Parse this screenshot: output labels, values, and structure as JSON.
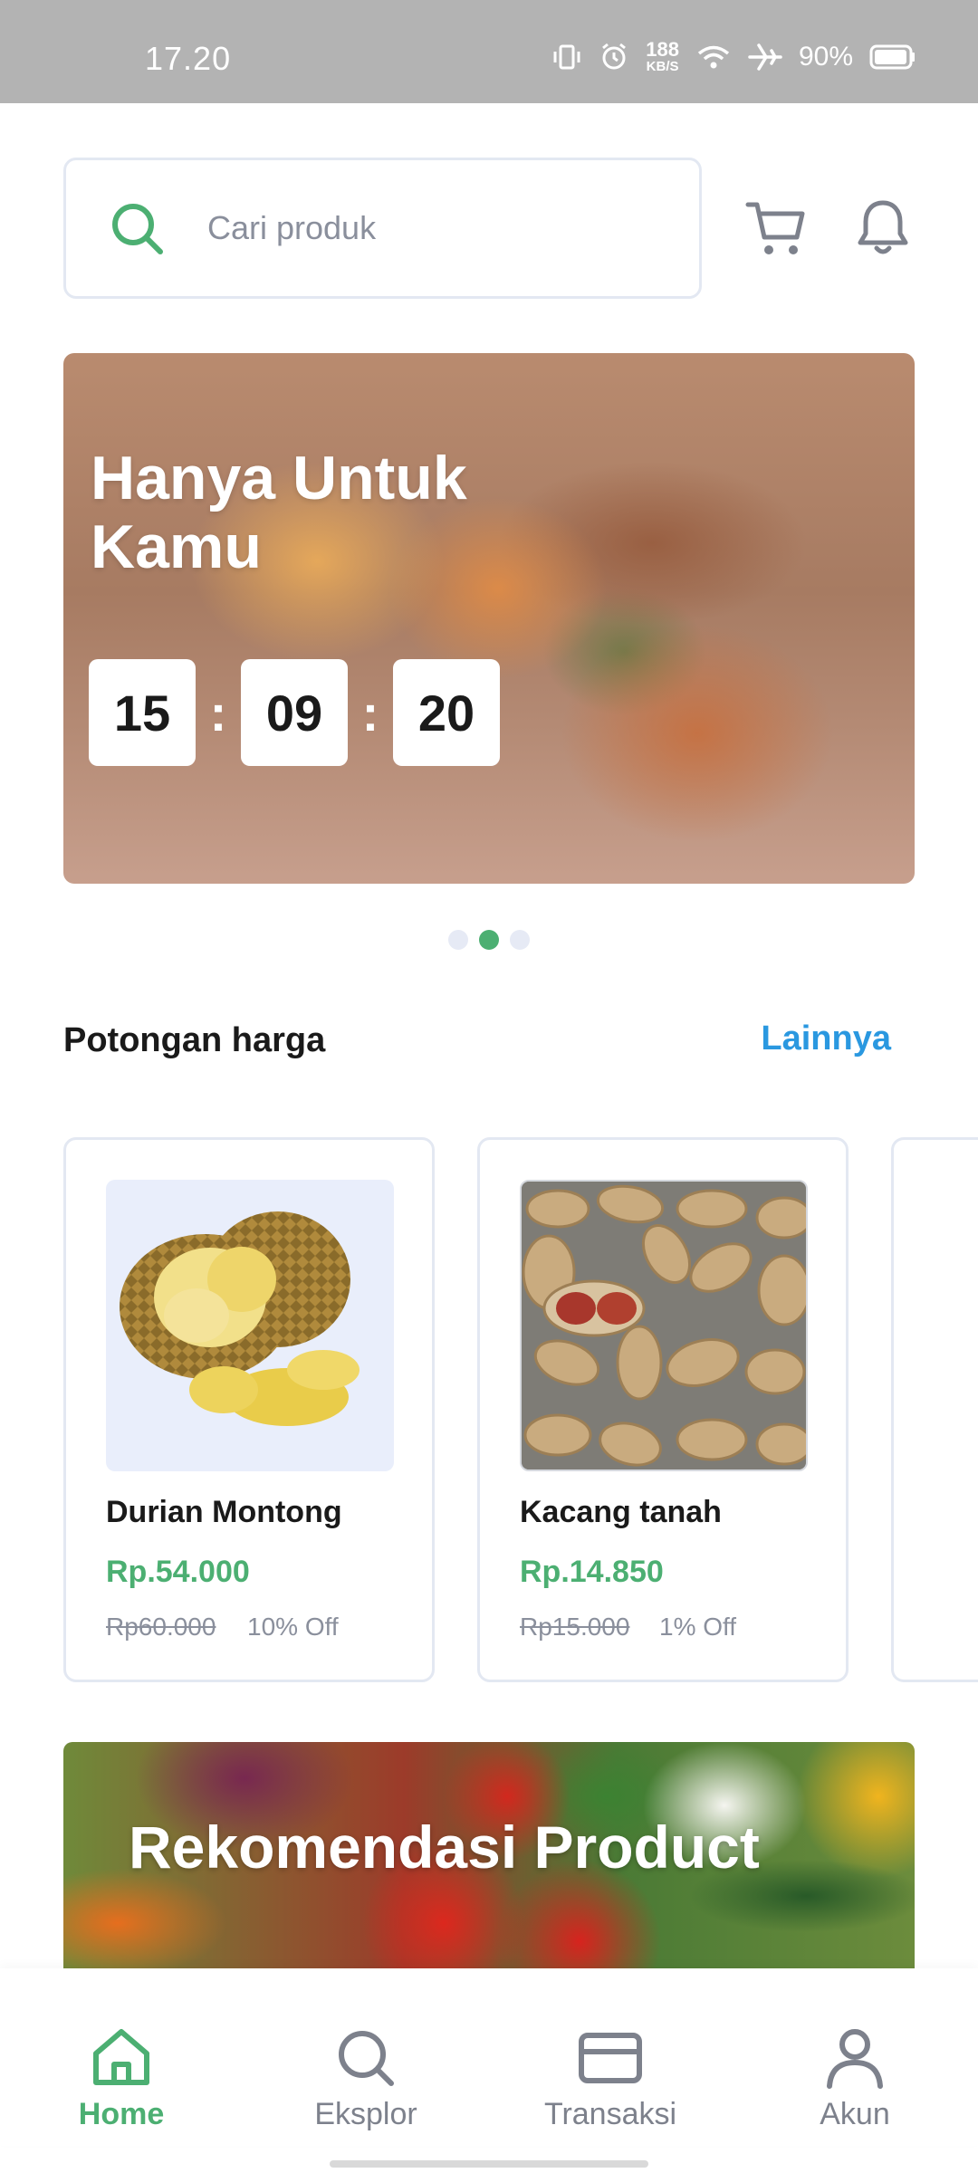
{
  "status_bar": {
    "time": "17.20",
    "net_speed": "188",
    "net_unit": "KB/S",
    "battery": "90%"
  },
  "search": {
    "placeholder": "Cari produk"
  },
  "icons": {
    "search": "search-icon",
    "cart": "cart-icon",
    "bell": "bell-icon",
    "home": "home-icon",
    "explore": "search-icon",
    "transaction": "card-icon",
    "account": "user-icon"
  },
  "banner": {
    "title": "Hanya Untuk Kamu",
    "timer": {
      "hours": "15",
      "minutes": "09",
      "seconds": "20",
      "separator": ":"
    },
    "carousel_pages": 3,
    "carousel_active": 2
  },
  "discount_section": {
    "title": "Potongan harga",
    "more_label": "Lainnya"
  },
  "products": [
    {
      "name": "Durian Montong",
      "price": "Rp.54.000",
      "original_price": "Rp60.000",
      "discount": "10% Off"
    },
    {
      "name": "Kacang tanah",
      "price": "Rp.14.850",
      "original_price": "Rp15.000",
      "discount": "1% Off"
    }
  ],
  "recommendation": {
    "title": "Rekomendasi Product"
  },
  "bottom_nav": {
    "items": [
      {
        "label": "Home",
        "active": true
      },
      {
        "label": "Eksplor",
        "active": false
      },
      {
        "label": "Transaksi",
        "active": false
      },
      {
        "label": "Akun",
        "active": false
      }
    ]
  },
  "colors": {
    "accent_green": "#4caf72",
    "link_blue": "#2a98e0",
    "status_bar_bg": "#b3b3b3",
    "border": "#e3e8f2"
  }
}
